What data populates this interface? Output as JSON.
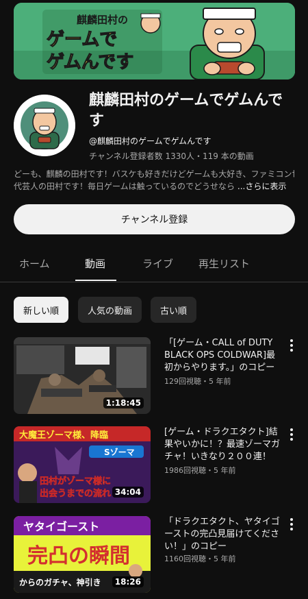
{
  "banner": {
    "line1": "麒麟田村の",
    "line2": "ゲームで",
    "line3": "ゲムんです"
  },
  "channel": {
    "name": "麒麟田村のゲームでゲムんです",
    "handle": "@麒麟田村のゲームでゲムんです",
    "meta": "チャンネル登録者数 1330人・119 本の動画",
    "description_line1": "どーも、麒麟の田村です！バスケも好きだけどゲームも大好き、ファミコン世",
    "description_line2": "代芸人の田村です！毎日ゲームは触っているのでどうせなら",
    "more_label": "...さらに表示",
    "subscribe_label": "チャンネル登録"
  },
  "tabs": [
    "ホーム",
    "動画",
    "ライブ",
    "再生リスト"
  ],
  "active_tab": "動画",
  "chips": [
    "新しい順",
    "人気の動画",
    "古い順"
  ],
  "selected_chip": "新しい順",
  "videos": [
    {
      "title": "「[ゲーム・CALL of DUTY BLACK OPS COLDWAR]最初からやります。」のコピー",
      "meta": "129回視聴・5 年前",
      "duration": "1:18:45"
    },
    {
      "title": "[ゲーム・ドラクエタクト]結果やいかに！？最速ゾーマガチャ！いきなり２００連！",
      "meta": "1986回視聴・5 年前",
      "duration": "34:04",
      "thumb_text1": "大魔王ゾーマ様、降臨",
      "thumb_text2": "Sゾーマ",
      "thumb_text3": "田村がゾーマ様に",
      "thumb_text4": "出会うまでの流れ"
    },
    {
      "title": "「ドラクエタクト、ヤタイゴーストの完凸見届けてください！」のコピー",
      "meta": "1160回視聴・5 年前",
      "duration": "18:26",
      "thumb_text1": "ヤタイゴースト",
      "thumb_text2": "完凸の瞬間",
      "thumb_text3": "からのガチャ、神引き"
    }
  ],
  "colors": {
    "background": "#0f0f0f",
    "text_primary": "#f1f1f1",
    "text_secondary": "#aaaaaa",
    "chip_bg": "#272727",
    "banner_green": "#4caf7a",
    "thumb_yellow": "#e8f23a"
  }
}
